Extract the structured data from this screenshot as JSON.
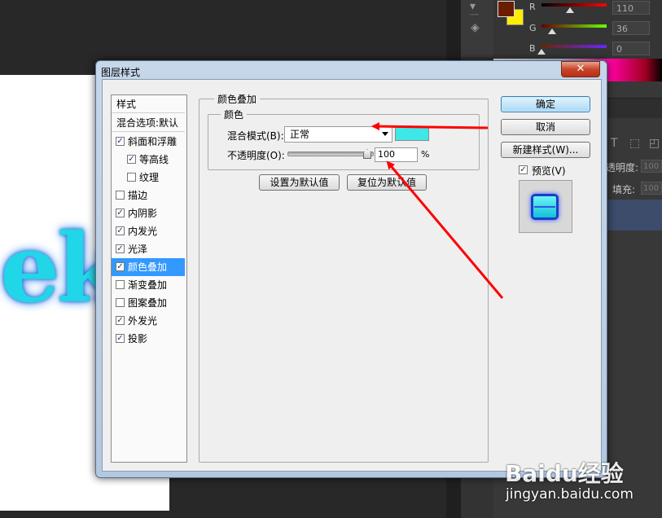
{
  "photoshop": {
    "color_panel": {
      "foreground_color": "#6a1d00",
      "background_color": "#ffee00",
      "channels": [
        {
          "label": "R",
          "value": "110"
        },
        {
          "label": "G",
          "value": "36"
        },
        {
          "label": "B",
          "value": "0"
        }
      ]
    },
    "canvas_text": "ek",
    "layers_panel": {
      "opacity_label": "透明度:",
      "opacity_value": "100",
      "fill_label": "填充:",
      "fill_value": "100"
    },
    "icons": [
      "text-tool-icon",
      "transform-icon",
      "layer-icon",
      "cube-icon"
    ]
  },
  "dialog": {
    "title": "图层样式",
    "close_label": "✕",
    "styles_list": {
      "header": "样式",
      "blend_options": "混合选项:默认",
      "items": [
        {
          "label": "斜面和浮雕",
          "checked": true,
          "indent": false,
          "selected": false
        },
        {
          "label": "等高线",
          "checked": true,
          "indent": true,
          "selected": false
        },
        {
          "label": "纹理",
          "checked": false,
          "indent": true,
          "selected": false
        },
        {
          "label": "描边",
          "checked": false,
          "indent": false,
          "selected": false
        },
        {
          "label": "内阴影",
          "checked": true,
          "indent": false,
          "selected": false
        },
        {
          "label": "内发光",
          "checked": true,
          "indent": false,
          "selected": false
        },
        {
          "label": "光泽",
          "checked": true,
          "indent": false,
          "selected": false
        },
        {
          "label": "颜色叠加",
          "checked": true,
          "indent": false,
          "selected": true
        },
        {
          "label": "渐变叠加",
          "checked": false,
          "indent": false,
          "selected": false
        },
        {
          "label": "图案叠加",
          "checked": false,
          "indent": false,
          "selected": false
        },
        {
          "label": "外发光",
          "checked": true,
          "indent": false,
          "selected": false
        },
        {
          "label": "投影",
          "checked": true,
          "indent": false,
          "selected": false
        }
      ]
    },
    "color_overlay": {
      "section_title": "颜色叠加",
      "group_title": "颜色",
      "blend_mode_label": "混合模式(B):",
      "blend_mode_value": "正常",
      "overlay_color": "#3ee8e8",
      "opacity_label": "不透明度(O):",
      "opacity_value": "100",
      "opacity_unit": "%",
      "opacity_level": 1.0,
      "set_default_label": "设置为默认值",
      "reset_default_label": "复位为默认值"
    },
    "buttons": {
      "ok": "确定",
      "cancel": "取消",
      "new_style": "新建样式(W)...",
      "preview_label": "预览(V)",
      "preview_checked": true
    }
  },
  "annotation": {
    "arrow_color": "#ff0000"
  },
  "watermark": {
    "logo": "Baidu经验",
    "url": "jingyan.baidu.com"
  }
}
